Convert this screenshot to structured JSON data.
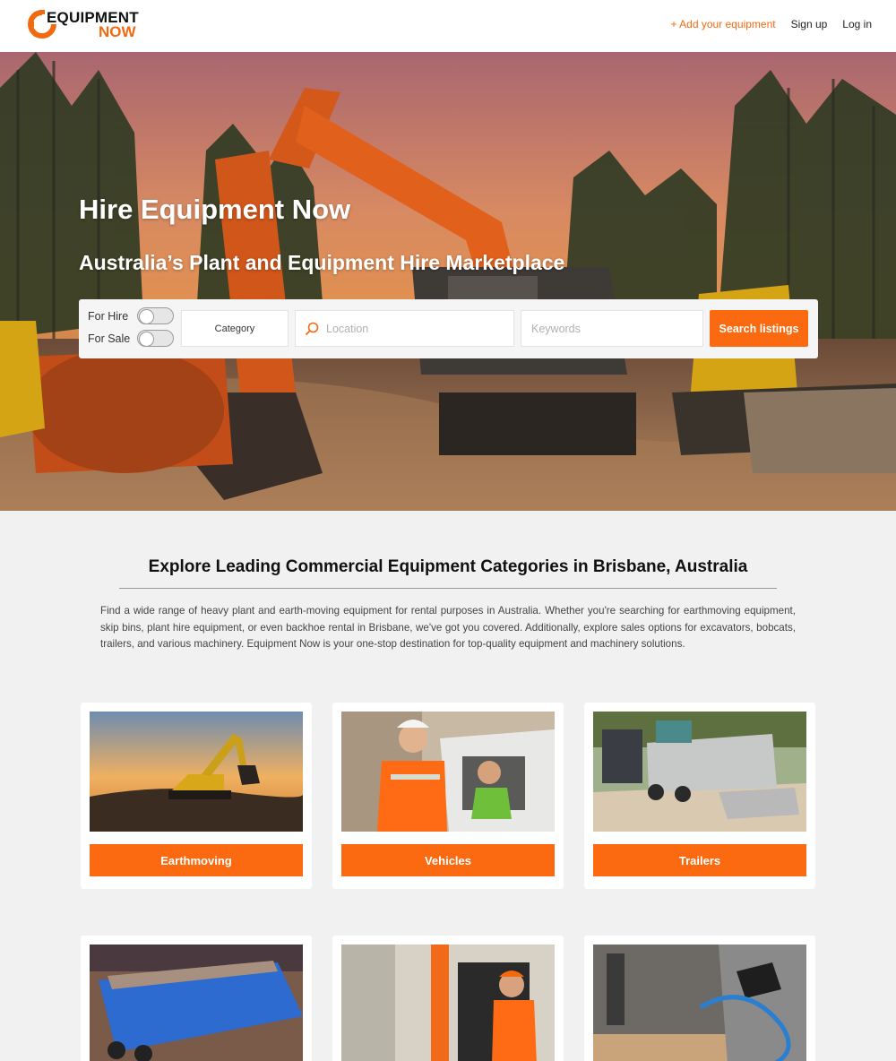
{
  "header": {
    "logo_line1": "EQUIPMENT",
    "logo_line2": "NOW",
    "nav": {
      "add": "+ Add your equipment",
      "signup": "Sign up",
      "login": "Log in"
    }
  },
  "hero": {
    "title": "Hire Equipment Now",
    "subtitle": "Australia’s Plant and Equipment Hire Marketplace",
    "search": {
      "for_hire_label": "For Hire",
      "for_sale_label": "For Sale",
      "for_hire_on": false,
      "for_sale_on": false,
      "category_label": "Category",
      "location_placeholder": "Location",
      "keywords_placeholder": "Keywords",
      "button_label": "Search listings"
    }
  },
  "explore": {
    "title": "Explore Leading Commercial Equipment Categories in Brisbane, Australia",
    "description": "Find a wide range of heavy plant and earth-moving equipment for rental purposes in Australia. Whether you're searching for earthmoving equipment, skip bins, plant hire equipment, or even backhoe rental in Brisbane, we've got you covered. Additionally, explore sales options for excavators, bobcats, trailers, and various machinery. Equipment Now is your one-stop destination for top-quality equipment and machinery solutions.",
    "categories": [
      {
        "label": "Earthmoving"
      },
      {
        "label": "Vehicles"
      },
      {
        "label": "Trailers"
      }
    ]
  },
  "colors": {
    "brand_orange": "#fb6a10",
    "page_bg": "#f1f1f1"
  }
}
